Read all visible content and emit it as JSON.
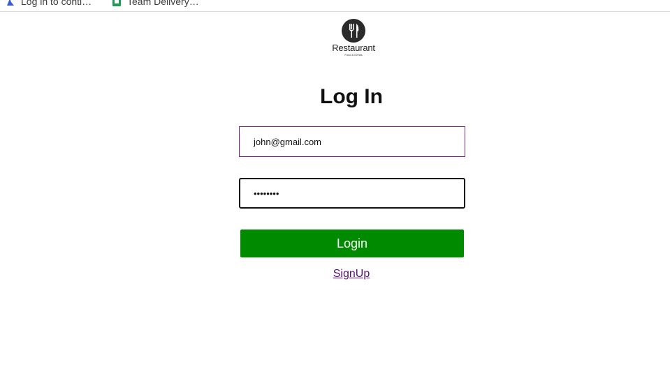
{
  "bookmarks": [
    {
      "label": "Log in to conti…",
      "icon": "atlassian-icon"
    },
    {
      "label": "Team Delivery…",
      "icon": "google-sheets-icon"
    }
  ],
  "logo": {
    "name": "Restaurant",
    "tagline": "Food & Drinks",
    "icon": "fork-knife-icon"
  },
  "page": {
    "title": "Log In"
  },
  "form": {
    "email_value": "john@gmail.com",
    "password_value": "••••••••",
    "login_label": "Login",
    "signup_label": "SignUp"
  },
  "colors": {
    "accent_green": "#008a00",
    "link_purple": "#5a0f7a",
    "email_border": "#7b1f8f"
  }
}
